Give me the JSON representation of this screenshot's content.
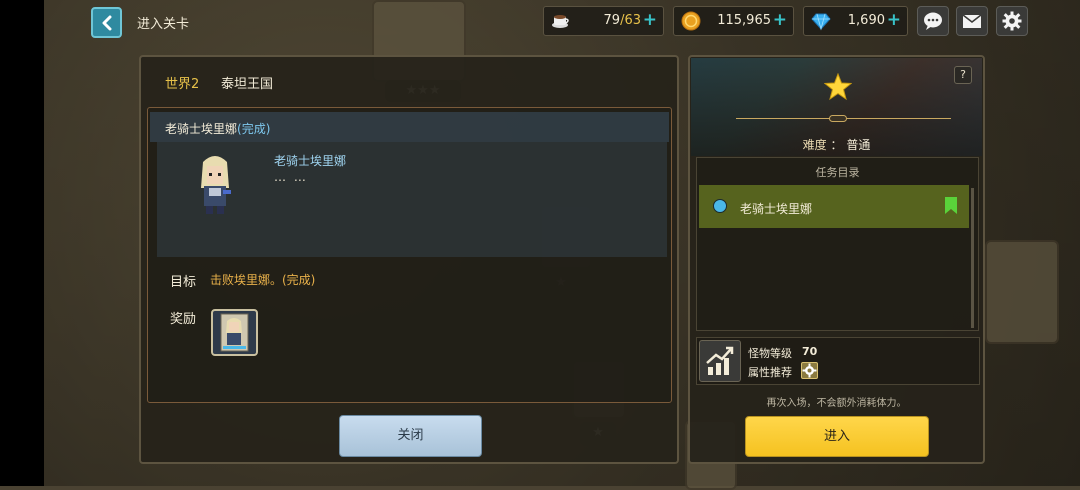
{
  "header": {
    "title": "进入关卡",
    "resources": [
      {
        "name": "stamina",
        "value": "79",
        "max": "/63"
      },
      {
        "name": "gold",
        "value": "115,965"
      },
      {
        "name": "diamond",
        "value": "1,690"
      }
    ]
  },
  "left_panel": {
    "world_tab": "世界2",
    "world_name": "泰坦王国",
    "mission_title": "老骑士埃里娜",
    "mission_status": "(完成)",
    "boss_name": "老骑士埃里娜",
    "boss_desc": "… …",
    "goal_label": "目标",
    "goal_text": "击败埃里娜。(完成)",
    "reward_label": "奖励",
    "close_button": "关闭"
  },
  "right_panel": {
    "help": "?",
    "difficulty_label": "难度",
    "difficulty_sep": "：",
    "difficulty_value": "普通",
    "task_header": "任务目录",
    "task_item": "老骑士埃里娜",
    "monster_level_label": "怪物等级",
    "monster_level": "70",
    "attr_label": "属性推荐",
    "note": "再次入场，不会额外消耗体力。",
    "enter_button": "进入"
  },
  "colors": {
    "accent_teal": "#38c2c8",
    "enter_yellow": "#f5c220",
    "task_green": "#56631e",
    "goal_orange": "#e8b04a"
  }
}
